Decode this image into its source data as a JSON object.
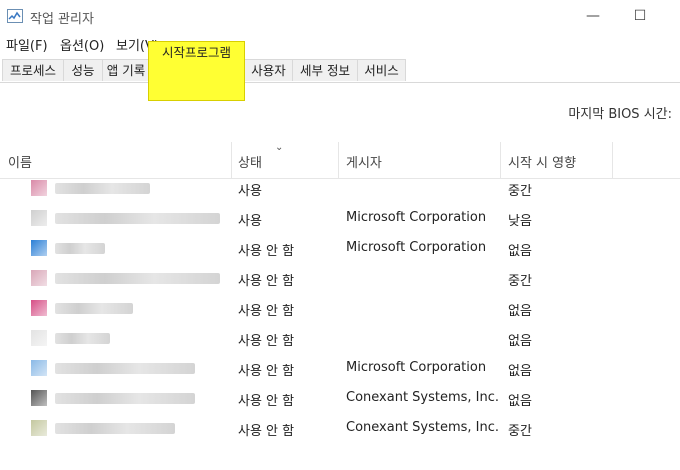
{
  "window": {
    "title": "작업 관리자",
    "minimize_glyph": "—",
    "maximize_glyph": "☐"
  },
  "menu": [
    "파일(F)",
    "옵션(O)",
    "보기(V)"
  ],
  "tabs": [
    "프로세스",
    "성능",
    "앱 기록",
    "시작프로그램",
    "사용자",
    "세부 정보",
    "서비스"
  ],
  "active_tab": "시작프로그램",
  "bios_label": "마지막 BIOS 시간:",
  "columns": {
    "name": "이름",
    "status": "상태",
    "publisher": "게시자",
    "impact": "시작 시 영향"
  },
  "rows": [
    {
      "icon_color": "#d98aa8",
      "status": "사용",
      "publisher": "",
      "impact": "중간"
    },
    {
      "icon_color": "#cfcfcf",
      "status": "사용",
      "publisher": "Microsoft Corporation",
      "impact": "낮음"
    },
    {
      "icon_color": "#2b7fd6",
      "status": "사용 안 함",
      "publisher": "Microsoft Corporation",
      "impact": "없음"
    },
    {
      "icon_color": "#d9a7b8",
      "status": "사용 안 함",
      "publisher": "",
      "impact": "중간"
    },
    {
      "icon_color": "#d64f86",
      "status": "사용 안 함",
      "publisher": "",
      "impact": "없음"
    },
    {
      "icon_color": "#e3e3e3",
      "status": "사용 안 함",
      "publisher": "",
      "impact": "없음"
    },
    {
      "icon_color": "#8ab9e6",
      "status": "사용 안 함",
      "publisher": "Microsoft Corporation",
      "impact": "없음"
    },
    {
      "icon_color": "#555555",
      "status": "사용 안 함",
      "publisher": "Conexant Systems, Inc.",
      "impact": "없음"
    },
    {
      "icon_color": "#c4c8a0",
      "status": "사용 안 함",
      "publisher": "Conexant Systems, Inc.",
      "impact": "중간"
    }
  ],
  "colors": {
    "highlight": "#ffff33",
    "header_text": "#444444"
  }
}
